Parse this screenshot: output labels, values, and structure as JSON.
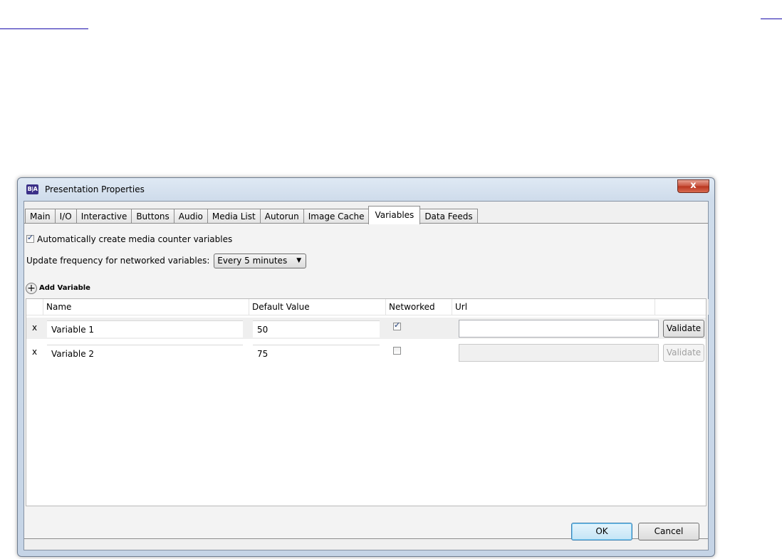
{
  "window": {
    "title": "Presentation Properties",
    "app_icon_text": "B|A",
    "close_glyph": "x"
  },
  "tabs": [
    {
      "label": "Main"
    },
    {
      "label": "I/O"
    },
    {
      "label": "Interactive"
    },
    {
      "label": "Buttons"
    },
    {
      "label": "Audio"
    },
    {
      "label": "Media List"
    },
    {
      "label": "Autorun"
    },
    {
      "label": "Image Cache"
    },
    {
      "label": "Variables",
      "active": true
    },
    {
      "label": "Data Feeds"
    }
  ],
  "options": {
    "auto_create_label": "Automatically create media counter variables",
    "auto_create_checked": true,
    "update_freq_label": "Update frequency for networked variables:",
    "update_freq_value": "Every 5 minutes",
    "add_variable_label": "Add Variable"
  },
  "grid": {
    "columns": [
      "Name",
      "Default Value",
      "Networked",
      "Url"
    ],
    "rows": [
      {
        "delete": "x",
        "name": "Variable 1",
        "default_value": "50",
        "networked": true,
        "url": "",
        "validate": "Validate"
      },
      {
        "delete": "x",
        "name": "Variable 2",
        "default_value": "75",
        "networked": false,
        "url": "",
        "validate": "Validate"
      }
    ]
  },
  "footer": {
    "ok_label": "OK",
    "cancel_label": "Cancel"
  }
}
